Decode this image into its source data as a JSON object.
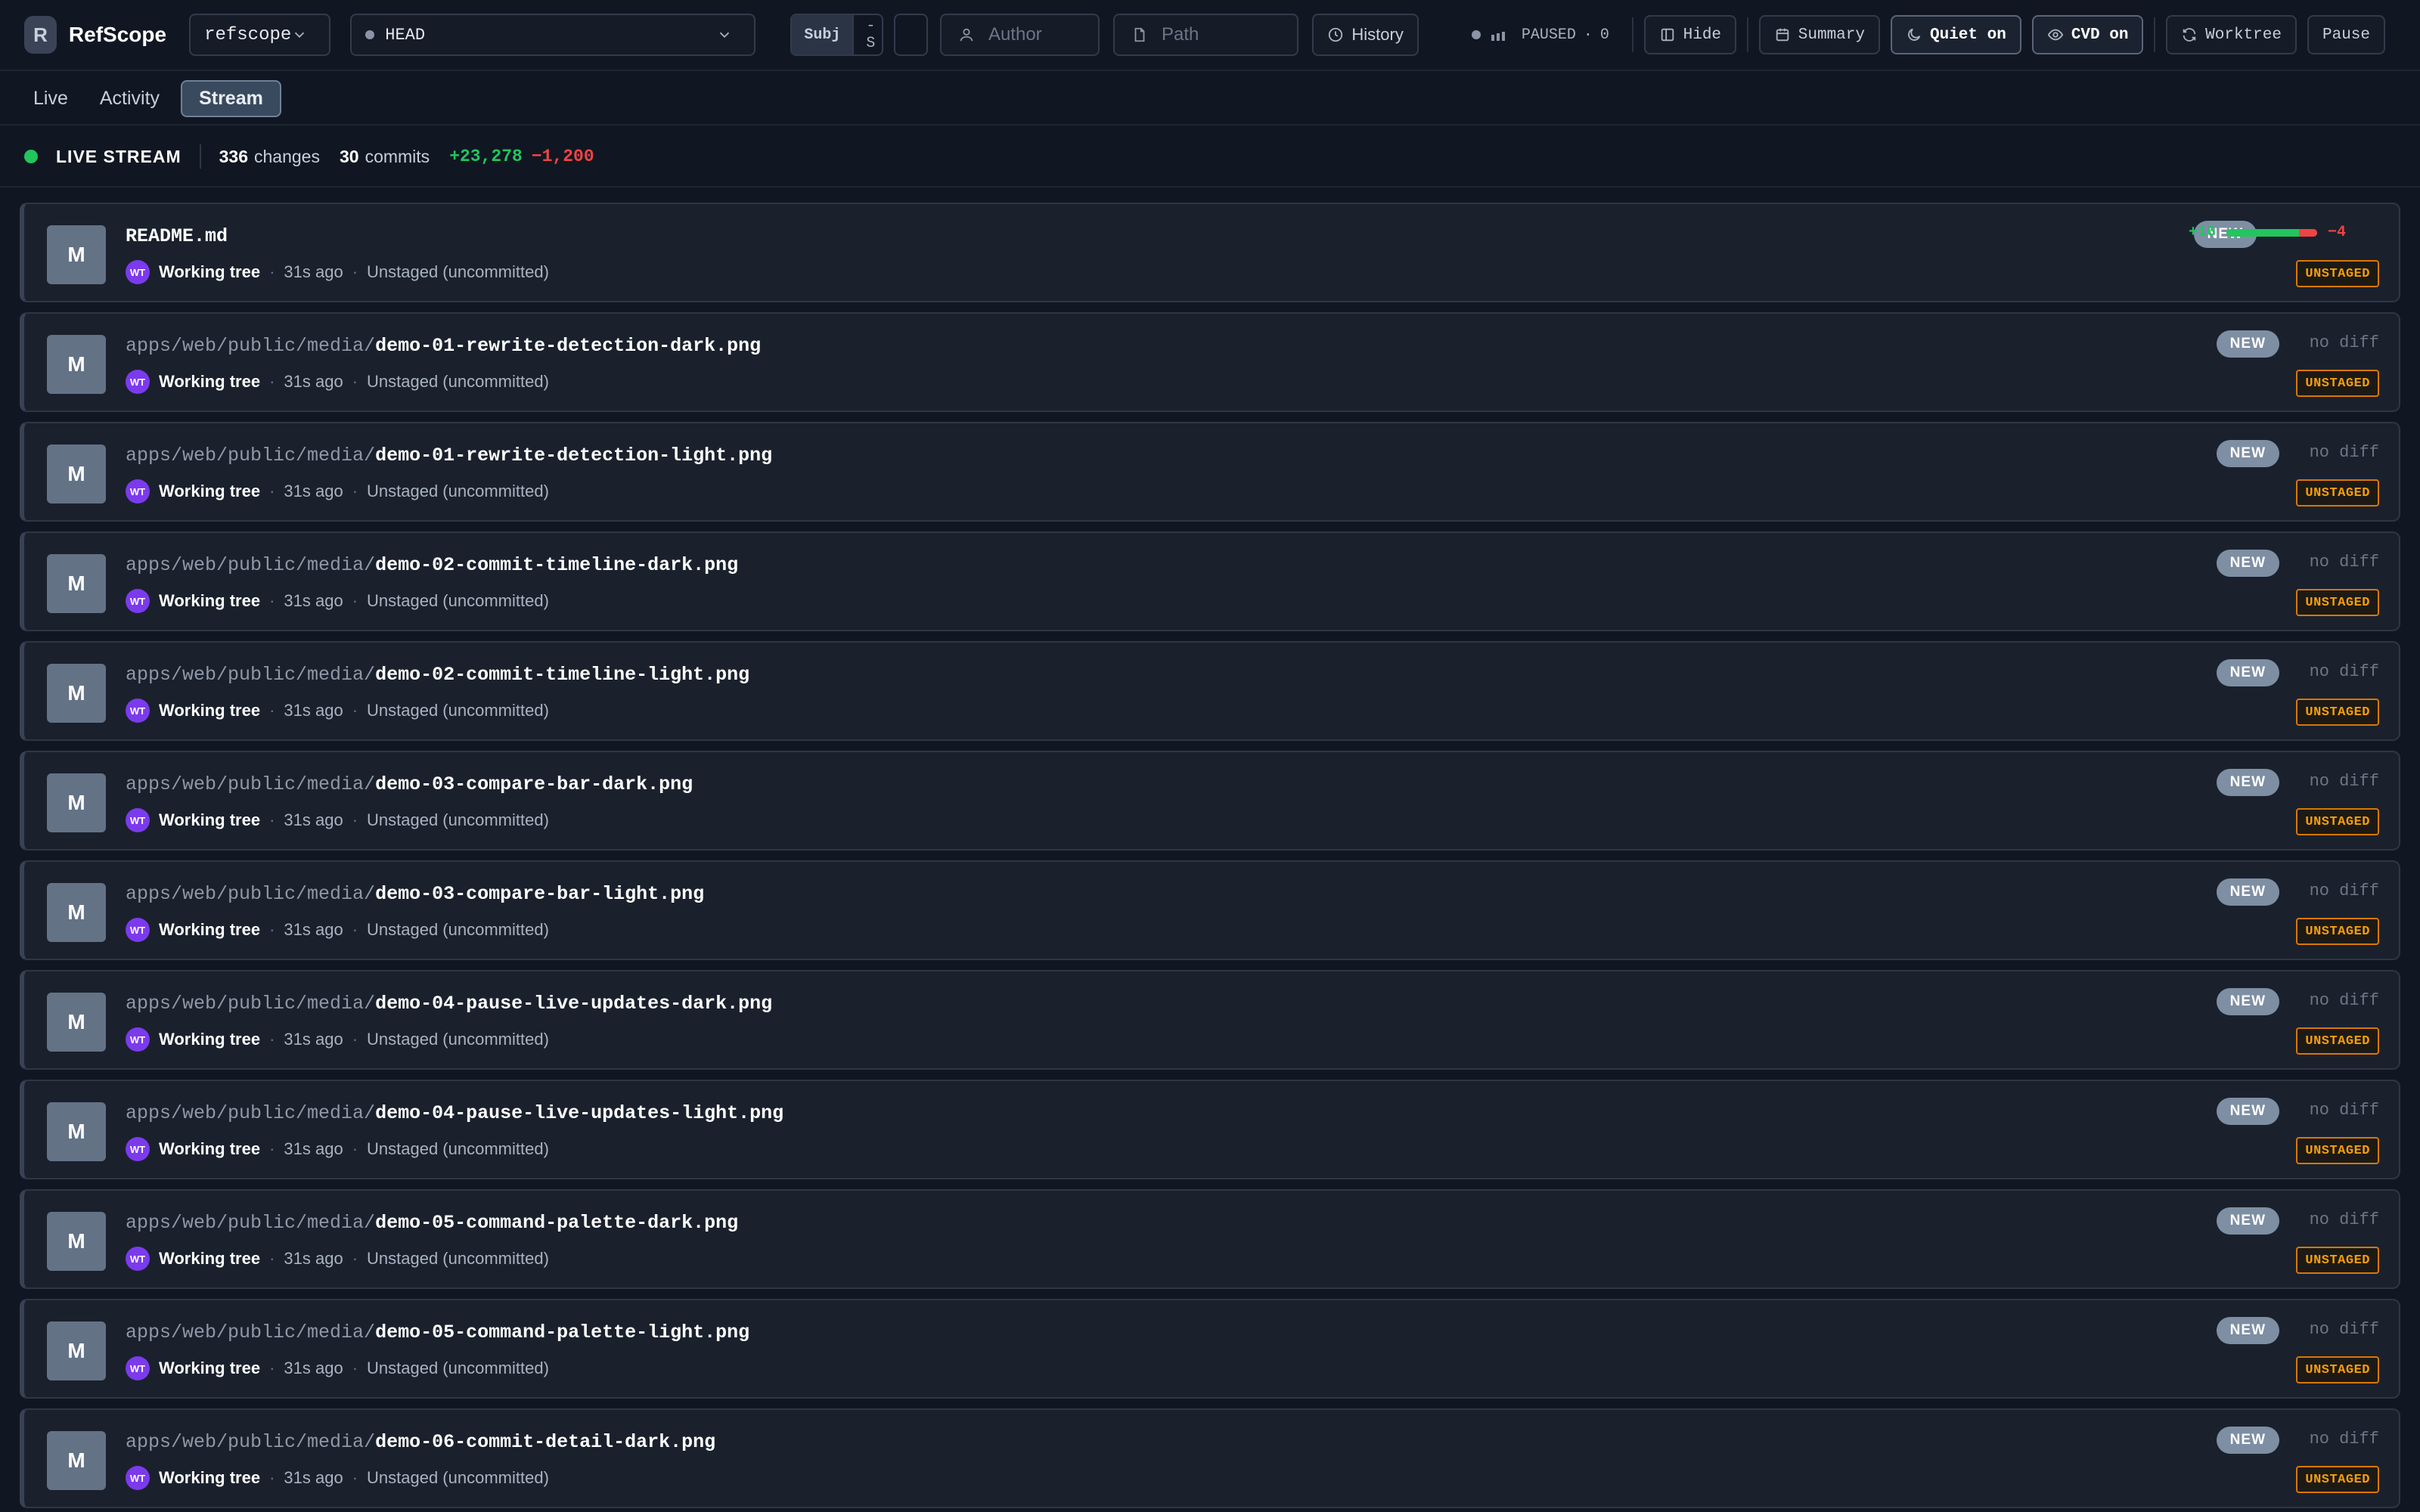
{
  "app": {
    "logo_letter": "R",
    "title": "RefScope"
  },
  "toolbar": {
    "repo": "refscope",
    "ref": "HEAD",
    "seg_subj": "Subj",
    "seg_s": "-S",
    "author_placeholder": "Author",
    "path_placeholder": "Path",
    "history": "History",
    "status_label": "PAUSED",
    "status_dot_sep": "·",
    "status_count": "0",
    "hide": "Hide",
    "summary": "Summary",
    "quiet": "Quiet on",
    "cvd": "CVD on",
    "worktree": "Worktree",
    "pause": "Pause"
  },
  "tabs": [
    {
      "label": "Live",
      "active": false
    },
    {
      "label": "Activity",
      "active": false
    },
    {
      "label": "Stream",
      "active": true
    }
  ],
  "stream": {
    "label": "LIVE STREAM",
    "changes_count": "336",
    "changes_label": "changes",
    "commits_count": "30",
    "commits_label": "commits",
    "additions": "+23,278",
    "deletions": "−1,200"
  },
  "colors": {
    "live": "#22c55e",
    "add": "#22c55e",
    "del": "#ef4444",
    "unstaged": "#f59e0b",
    "avatar": "#7c3aed"
  },
  "rows": [
    {
      "status": "M",
      "dir": "",
      "base": "README.md",
      "who": "Working tree",
      "age": "31s ago",
      "state": "Unstaged (uncommitted)",
      "badge": "NEW",
      "add": "+16",
      "del": "−4",
      "add_fraction": 0.8,
      "nodiff": "",
      "tag": "UNSTAGED"
    },
    {
      "status": "M",
      "dir": "apps/web/public/media/",
      "base": "demo-01-rewrite-detection-dark.png",
      "who": "Working tree",
      "age": "31s ago",
      "state": "Unstaged (uncommitted)",
      "badge": "NEW",
      "nodiff": "no diff",
      "tag": "UNSTAGED"
    },
    {
      "status": "M",
      "dir": "apps/web/public/media/",
      "base": "demo-01-rewrite-detection-light.png",
      "who": "Working tree",
      "age": "31s ago",
      "state": "Unstaged (uncommitted)",
      "badge": "NEW",
      "nodiff": "no diff",
      "tag": "UNSTAGED"
    },
    {
      "status": "M",
      "dir": "apps/web/public/media/",
      "base": "demo-02-commit-timeline-dark.png",
      "who": "Working tree",
      "age": "31s ago",
      "state": "Unstaged (uncommitted)",
      "badge": "NEW",
      "nodiff": "no diff",
      "tag": "UNSTAGED"
    },
    {
      "status": "M",
      "dir": "apps/web/public/media/",
      "base": "demo-02-commit-timeline-light.png",
      "who": "Working tree",
      "age": "31s ago",
      "state": "Unstaged (uncommitted)",
      "badge": "NEW",
      "nodiff": "no diff",
      "tag": "UNSTAGED"
    },
    {
      "status": "M",
      "dir": "apps/web/public/media/",
      "base": "demo-03-compare-bar-dark.png",
      "who": "Working tree",
      "age": "31s ago",
      "state": "Unstaged (uncommitted)",
      "badge": "NEW",
      "nodiff": "no diff",
      "tag": "UNSTAGED"
    },
    {
      "status": "M",
      "dir": "apps/web/public/media/",
      "base": "demo-03-compare-bar-light.png",
      "who": "Working tree",
      "age": "31s ago",
      "state": "Unstaged (uncommitted)",
      "badge": "NEW",
      "nodiff": "no diff",
      "tag": "UNSTAGED"
    },
    {
      "status": "M",
      "dir": "apps/web/public/media/",
      "base": "demo-04-pause-live-updates-dark.png",
      "who": "Working tree",
      "age": "31s ago",
      "state": "Unstaged (uncommitted)",
      "badge": "NEW",
      "nodiff": "no diff",
      "tag": "UNSTAGED"
    },
    {
      "status": "M",
      "dir": "apps/web/public/media/",
      "base": "demo-04-pause-live-updates-light.png",
      "who": "Working tree",
      "age": "31s ago",
      "state": "Unstaged (uncommitted)",
      "badge": "NEW",
      "nodiff": "no diff",
      "tag": "UNSTAGED"
    },
    {
      "status": "M",
      "dir": "apps/web/public/media/",
      "base": "demo-05-command-palette-dark.png",
      "who": "Working tree",
      "age": "31s ago",
      "state": "Unstaged (uncommitted)",
      "badge": "NEW",
      "nodiff": "no diff",
      "tag": "UNSTAGED"
    },
    {
      "status": "M",
      "dir": "apps/web/public/media/",
      "base": "demo-05-command-palette-light.png",
      "who": "Working tree",
      "age": "31s ago",
      "state": "Unstaged (uncommitted)",
      "badge": "NEW",
      "nodiff": "no diff",
      "tag": "UNSTAGED"
    },
    {
      "status": "M",
      "dir": "apps/web/public/media/",
      "base": "demo-06-commit-detail-dark.png",
      "who": "Working tree",
      "age": "31s ago",
      "state": "Unstaged (uncommitted)",
      "badge": "NEW",
      "nodiff": "no diff",
      "tag": "UNSTAGED"
    }
  ],
  "avatar_initials": "WT",
  "meta_sep": "·"
}
